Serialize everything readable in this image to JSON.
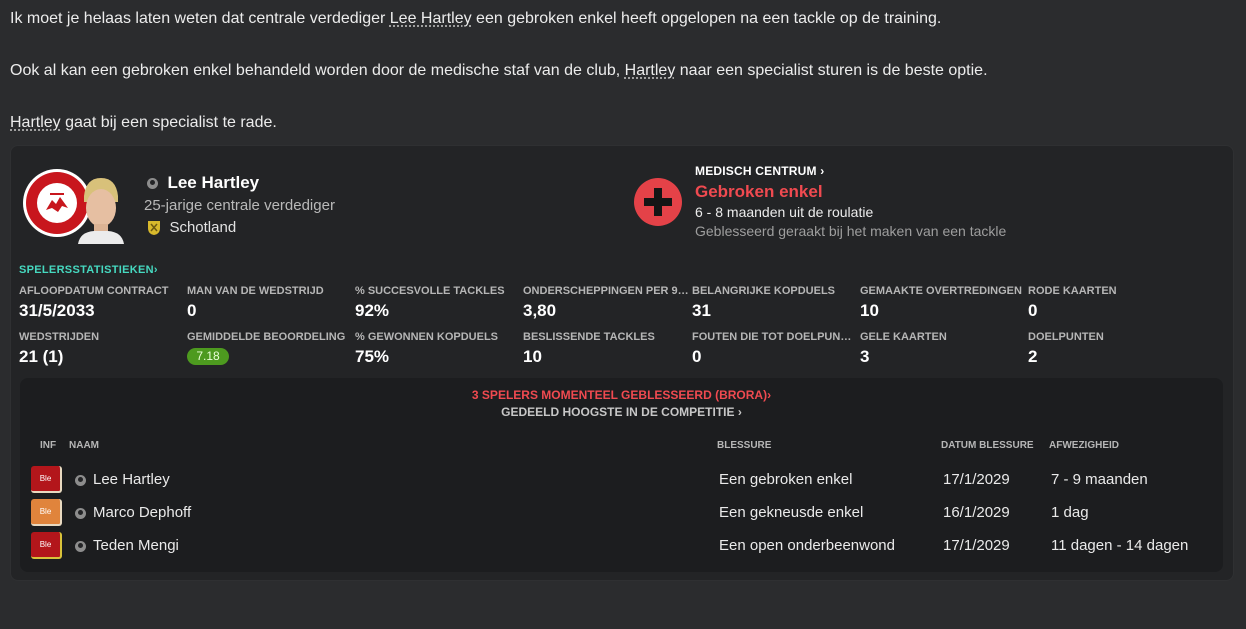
{
  "message": {
    "line1_pre": "Ik moet je helaas laten weten dat centrale verdediger ",
    "line1_link": "Lee Hartley",
    "line1_post": " een gebroken enkel heeft opgelopen na een tackle op de training.",
    "line2_pre": "Ook al kan een gebroken enkel behandeld worden door de medische staf van de club, ",
    "line2_link": "Hartley",
    "line2_post": " naar een specialist sturen is de beste optie.",
    "line3_link": "Hartley",
    "line3_post": " gaat bij een specialist te rade."
  },
  "player": {
    "name": "Lee Hartley",
    "description": "25-jarige centrale verdediger",
    "nationality": "Schotland",
    "club_badge_text": "BRORA RANGERS FOOTBALL"
  },
  "medical": {
    "header": "MEDISCH CENTRUM",
    "injury": "Gebroken enkel",
    "duration": "6 - 8 maanden uit de roulatie",
    "cause": "Geblesseerd geraakt bij het maken van een tackle"
  },
  "stats_link": "SPELERSSTATISTIEKEN",
  "stats": [
    {
      "label": "AFLOOPDATUM CONTRACT",
      "value": "31/5/2033"
    },
    {
      "label": "MAN VAN DE WEDSTRIJD",
      "value": "0"
    },
    {
      "label": "% SUCCESVOLLE TACKLES",
      "value": "92%"
    },
    {
      "label": "ONDERSCHEPPINGEN PER 90...",
      "value": "3,80"
    },
    {
      "label": "BELANGRIJKE KOPDUELS",
      "value": "31"
    },
    {
      "label": "GEMAAKTE OVERTREDINGEN",
      "value": "10"
    },
    {
      "label": "RODE KAARTEN",
      "value": "0"
    },
    {
      "label": "WEDSTRIJDEN",
      "value": "21 (1)"
    },
    {
      "label": "GEMIDDELDE BEOORDELING",
      "value": "7.18"
    },
    {
      "label": "% GEWONNEN KOPDUELS",
      "value": "75%"
    },
    {
      "label": "BESLISSENDE TACKLES",
      "value": "10"
    },
    {
      "label": "FOUTEN DIE TOT DOELPUNT L...",
      "value": "0"
    },
    {
      "label": "GELE KAARTEN",
      "value": "3"
    },
    {
      "label": "DOELPUNTEN",
      "value": "2"
    }
  ],
  "injured": {
    "header": "3 SPELERS MOMENTEEL GEBLESSEERD (BRORA)",
    "subheader": "GEDEELD HOOGSTE IN DE COMPETITIE",
    "columns": {
      "inf": "INF",
      "name": "NAAM",
      "injury": "BLESSURE",
      "date": "DATUM BLESSURE",
      "absence": "AFWEZIGHEID"
    },
    "rows": [
      {
        "badge": "Ble",
        "badge_color": "#b3161b",
        "name": "Lee Hartley",
        "injury": "Een gebroken enkel",
        "date": "17/1/2029",
        "absence": "7 - 9 maanden"
      },
      {
        "badge": "Ble",
        "badge_color": "#e0843c",
        "name": "Marco Dephoff",
        "injury": "Een gekneusde enkel",
        "date": "16/1/2029",
        "absence": "1 dag"
      },
      {
        "badge": "Ble",
        "badge_color": "#b3161b",
        "name": "Teden Mengi",
        "injury": "Een open onderbeenwond",
        "date": "17/1/2029",
        "absence": "11 dagen - 14 dagen"
      }
    ]
  },
  "colors": {
    "injury_red": "#f04a50",
    "link_teal": "#46d9c0",
    "rating_green": "#4d9a1f"
  }
}
